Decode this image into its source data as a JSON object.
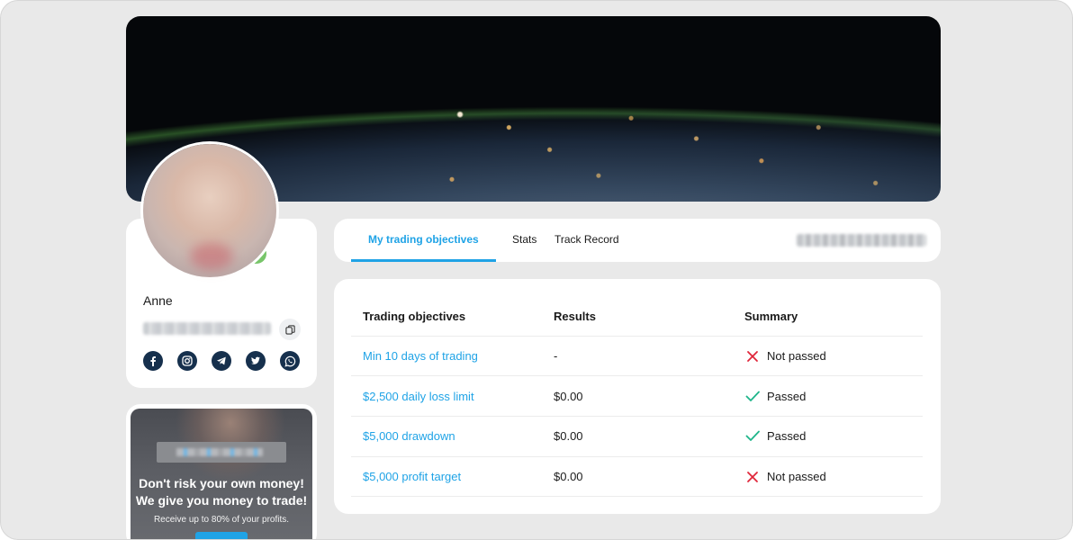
{
  "profile": {
    "name": "Anne",
    "social_icons": [
      "facebook-icon",
      "instagram-icon",
      "telegram-icon",
      "twitter-icon",
      "whatsapp-icon"
    ]
  },
  "promo": {
    "headline_line1": "Don't risk your own money!",
    "headline_line2": "We give you money to trade!",
    "subtext": "Receive up to 80% of your profits."
  },
  "tabs": [
    {
      "label": "My trading objectives",
      "active": true
    },
    {
      "label": "Stats",
      "active": false
    },
    {
      "label": "Track Record",
      "active": false
    }
  ],
  "table": {
    "headers": [
      "Trading objectives",
      "Results",
      "Summary"
    ],
    "rows": [
      {
        "objective": "Min 10 days of trading",
        "result": "-",
        "summary": "Not passed",
        "status": "fail"
      },
      {
        "objective": "$2,500 daily loss limit",
        "result": "$0.00",
        "summary": "Passed",
        "status": "pass"
      },
      {
        "objective": "$5,000 drawdown",
        "result": "$0.00",
        "summary": "Passed",
        "status": "pass"
      },
      {
        "objective": "$5,000 profit target",
        "result": "$0.00",
        "summary": "Not passed",
        "status": "fail"
      }
    ]
  },
  "colors": {
    "accent": "#1fa3e6",
    "pass": "#1fb58a",
    "fail": "#e0263a",
    "social_bg": "#16304d"
  }
}
